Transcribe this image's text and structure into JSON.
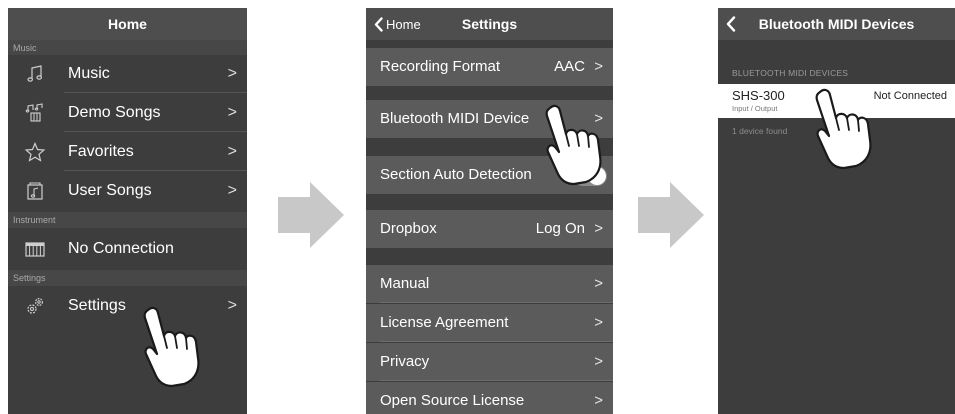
{
  "screen1": {
    "title": "Home",
    "sections": [
      {
        "header": "Music",
        "items": [
          {
            "label": "Music",
            "icon": "music-note-icon"
          },
          {
            "label": "Demo Songs",
            "icon": "demo-songs-icon"
          },
          {
            "label": "Favorites",
            "icon": "star-icon"
          },
          {
            "label": "User Songs",
            "icon": "user-songs-icon"
          }
        ]
      },
      {
        "header": "Instrument",
        "items": [
          {
            "label": "No Connection",
            "icon": "keyboard-icon"
          }
        ]
      },
      {
        "header": "Settings",
        "items": [
          {
            "label": "Settings",
            "icon": "gears-icon"
          }
        ]
      }
    ],
    "chevron": ">"
  },
  "screen2": {
    "back_label": "Home",
    "title": "Settings",
    "rows": [
      {
        "label": "Recording Format",
        "value": "AAC"
      },
      {
        "label": "Bluetooth MIDI Device",
        "value": ""
      },
      {
        "label": "Section Auto Detection",
        "toggle": true
      },
      {
        "label": "Dropbox",
        "value": "Log On"
      },
      {
        "label": "Manual",
        "value": ""
      },
      {
        "label": "License Agreement",
        "value": ""
      },
      {
        "label": "Privacy",
        "value": ""
      },
      {
        "label": "Open Source License",
        "value": ""
      }
    ],
    "chevron": ">"
  },
  "screen3": {
    "title": "Bluetooth MIDI Devices",
    "section_header": "BLUETOOTH MIDI DEVICES",
    "device": {
      "name": "SHS-300",
      "subtitle": "Input / Output",
      "status": "Not Connected"
    },
    "footer": "1 device found"
  },
  "colors": {
    "screen_bg": "#3d3d3d",
    "navbar_bg": "#4e4e4e",
    "settings_row_bg": "#5b5b5b",
    "arrow": "#c8c8c8"
  }
}
